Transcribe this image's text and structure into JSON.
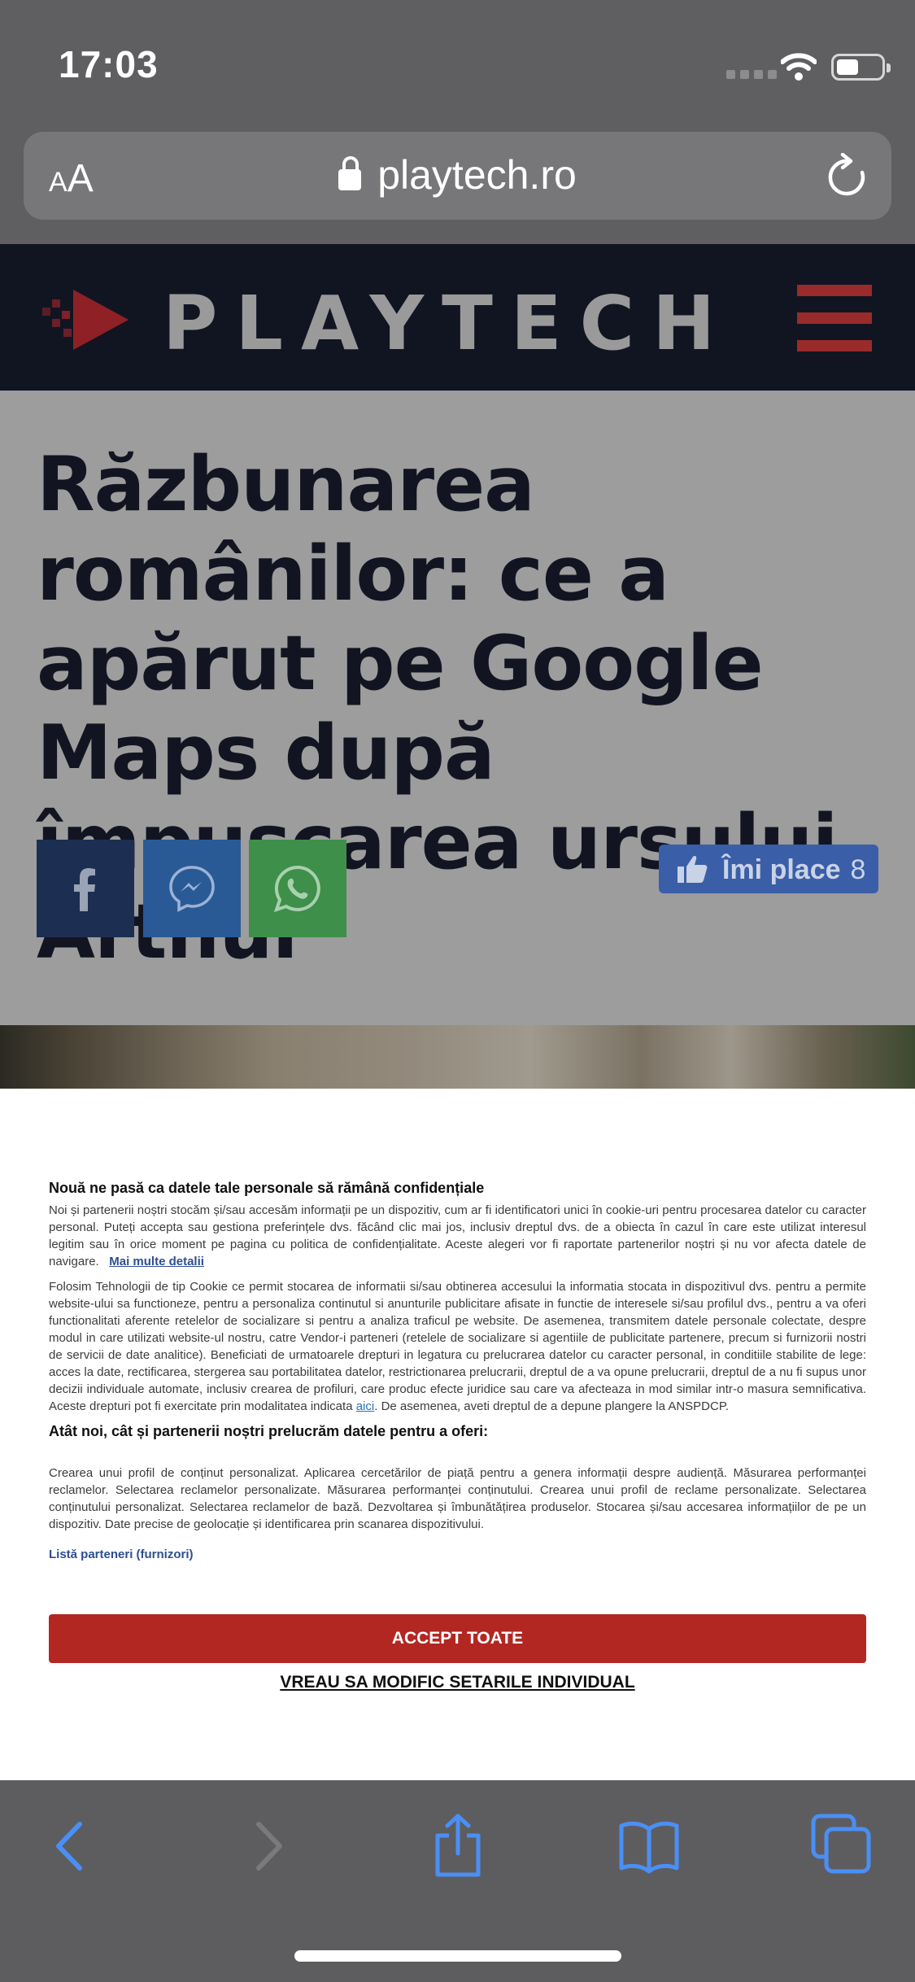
{
  "status_bar": {
    "time": "17:03"
  },
  "url_bar": {
    "text_size_label_small": "A",
    "text_size_label_large": "A",
    "domain": "playtech.ro"
  },
  "site_header": {
    "logo_text": "PLAYTECH"
  },
  "article": {
    "title": "Răzbunarea românilor: ce a apărut pe Google Maps după împușcarea ursului Arthur",
    "like_label": "Îmi place",
    "like_count": "8"
  },
  "consent": {
    "heading": "Nouă ne pasă ca datele tale personale să rămână confidențiale",
    "para1": "Noi și partenerii noștri stocăm și/sau accesăm informații pe un dispozitiv, cum ar fi identificatori unici în cookie-uri pentru procesarea datelor cu caracter personal. Puteți accepta sau gestiona preferințele dvs. făcând clic mai jos, inclusiv dreptul dvs. de a obiecta în cazul în care este utilizat interesul legitim sau în orice moment pe pagina cu politica de confidențialitate. Aceste alegeri vor fi raportate partenerilor noștri și nu vor afecta datele de navigare.",
    "more_details": "Mai multe detalii",
    "para2a": "Folosim Tehnologii de tip Cookie ce permit stocarea de informatii si/sau obtinerea accesului la informatia stocata in dispozitivul dvs. pentru a permite website-ului sa functioneze, pentru a personaliza continutul si anunturile publicitare afisate in functie de interesele si/sau profilul dvs., pentru a va oferi functionalitati aferente retelelor de socializare si pentru a analiza traficul pe website. De asemenea, transmitem datele personale colectate, despre modul in care utilizati website-ul nostru, catre Vendor-i parteneri (retelele de socializare si agentiile de publicitate partenere, precum si furnizorii nostri de servicii de date analitice). Beneficiati de urmatoarele drepturi in legatura cu prelucrarea datelor cu caracter personal, in conditiile stabilite de lege: acces la date, rectificarea, stergerea sau portabilitatea datelor, restrictionarea prelucrarii, dreptul de a va opune prelucrarii, dreptul de a nu fi supus unor decizii individuale automate, inclusiv crearea de profiluri, care produc efecte juridice sau care va afecteaza in mod similar intr-o masura semnificativa. Aceste drepturi pot fi exercitate prin modalitatea indicata",
    "aici": "aici",
    "para2b": ". De asemenea, aveti dreptul de a depune plangere la ANSPDCP.",
    "heading2": "Atât noi, cât și partenerii noștri prelucrăm datele pentru a oferi:",
    "para3": "Crearea unui profil de conținut personalizat. Aplicarea cercetărilor de piață pentru a genera informații despre audiență. Măsurarea performanței reclamelor. Selectarea reclamelor personalizate. Măsurarea performanței conținutului. Crearea unui profil de reclame personalizate. Selectarea conținutului personalizat. Selectarea reclamelor de bază. Dezvoltarea și îmbunătățirea produselor. Stocarea și/sau accesarea informațiilor de pe un dispozitiv. Date precise de geolocație și identificarea prin scanarea dispozitivului.",
    "partners_link": "Listă parteneri (furnizori)",
    "accept_label": "ACCEPT TOATE",
    "modify_label": "VREAU SA MODIFIC SETARILE INDIVIDUAL"
  },
  "toolbar": {
    "icons": [
      "back-icon",
      "forward-icon",
      "share-icon",
      "bookmarks-icon",
      "tabs-icon"
    ]
  },
  "colors": {
    "accept_button": "#b22722",
    "toolbar_icon": "#4a8ff5",
    "header_bg": "#111522",
    "link": "#2c4f8f"
  }
}
